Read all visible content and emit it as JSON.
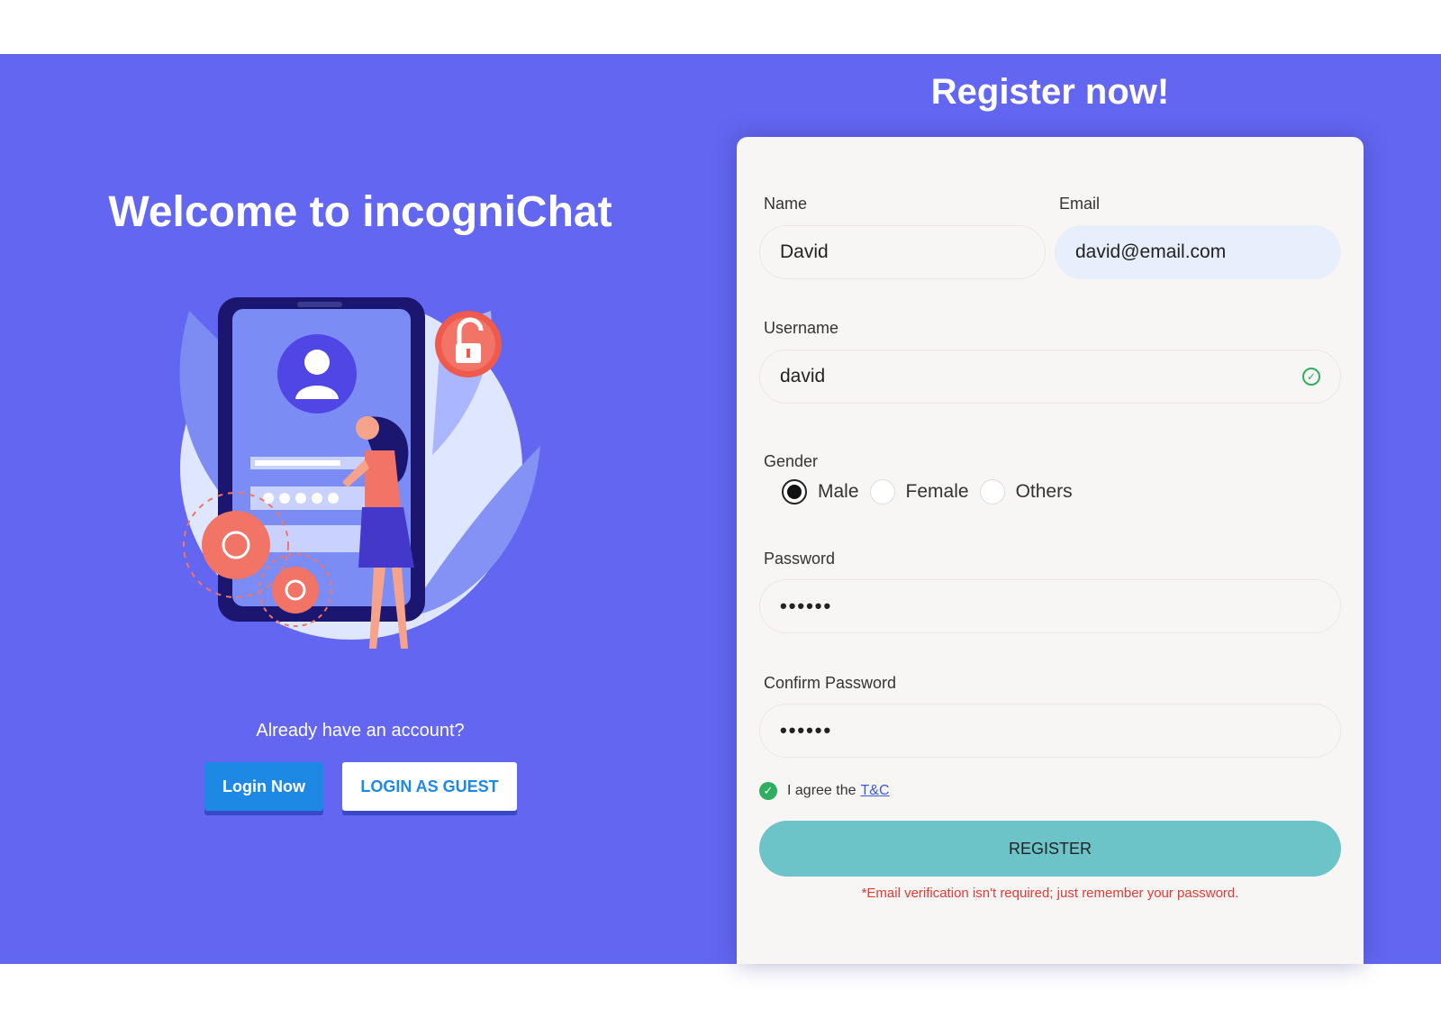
{
  "left": {
    "title": "Welcome to incogniChat",
    "already_text": "Already have an account?",
    "login_label": "Login Now",
    "guest_label": "LOGIN AS GUEST"
  },
  "form": {
    "title": "Register now!",
    "name_label": "Name",
    "name_value": "David",
    "email_label": "Email",
    "email_value": "david@email.com",
    "username_label": "Username",
    "username_value": "david",
    "gender_label": "Gender",
    "gender_options": [
      "Male",
      "Female",
      "Others"
    ],
    "gender_selected": "Male",
    "password_label": "Password",
    "password_value": "••••••",
    "confirm_label": "Confirm Password",
    "confirm_value": "••••••",
    "agree_text": "I agree the",
    "agree_link": "T&C",
    "agree_checked": true,
    "register_label": "REGISTER",
    "note": "*Email verification isn't required; just remember your password."
  },
  "colors": {
    "background": "#6366f1",
    "card": "#f8f6f4",
    "primary_button": "#1e88e5",
    "register_button": "#6cc3c8",
    "success": "#2eae5f",
    "note": "#e53935"
  }
}
